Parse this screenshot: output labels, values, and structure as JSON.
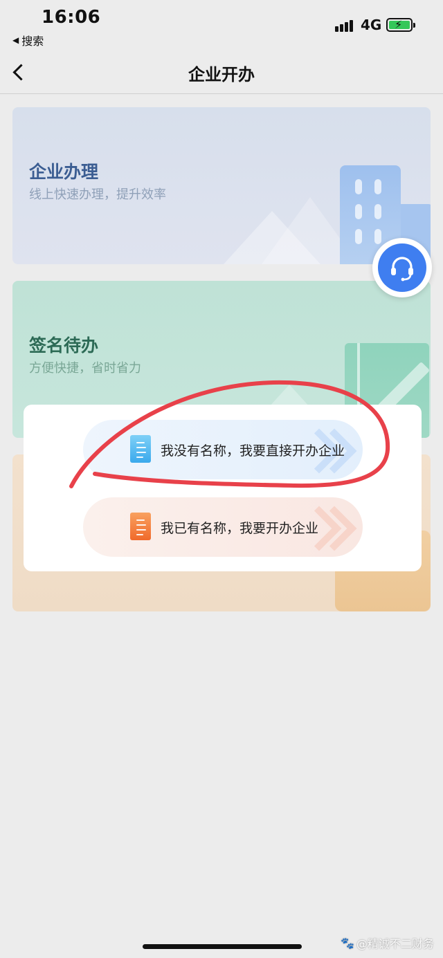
{
  "status_bar": {
    "time": "16:06",
    "back_app": "搜索",
    "network": "4G",
    "battery_color": "#34c759"
  },
  "nav": {
    "title": "企业开办",
    "back_icon": "chevron-left-icon"
  },
  "cards": [
    {
      "title": "企业办理",
      "subtitle": "线上快速办理，提升效率",
      "illustration": "building-icon"
    },
    {
      "title": "签名待办",
      "subtitle": "方便快捷，省时省力",
      "illustration": "notebook-pen-icon"
    },
    {
      "illustration": "suitcase-icon"
    }
  ],
  "support": {
    "icon": "headset-icon",
    "color": "#3f7ef0"
  },
  "modal": {
    "options": [
      {
        "label": "我没有名称，我要直接开办企业",
        "icon": "document-blue-icon",
        "color": "#3aa9ec"
      },
      {
        "label": "我已有名称，我要开办企业",
        "icon": "document-orange-icon",
        "color": "#f06a2b"
      }
    ]
  },
  "annotation": {
    "color": "#e8414a"
  },
  "watermark": {
    "text": "@精诚不二财务"
  }
}
